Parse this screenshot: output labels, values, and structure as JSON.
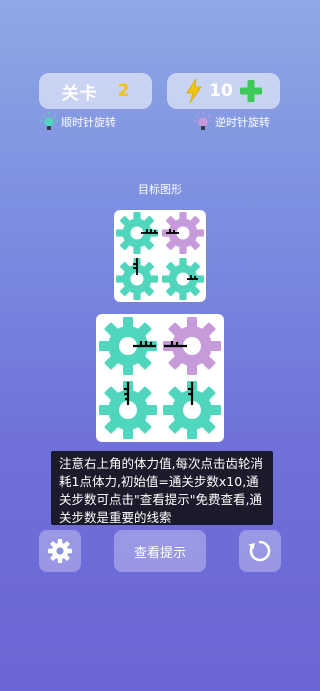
{
  "header": {
    "level_label": "关卡",
    "level_value": "2",
    "energy_value": "10",
    "energy_icon": "lightning-bolt-icon",
    "add_icon": "plus-icon"
  },
  "hints": {
    "clockwise_label": "顺时针旋转",
    "counterclockwise_label": "逆时针旋转"
  },
  "target": {
    "title": "目标图形"
  },
  "tip": {
    "text": "注意右上角的体力值,每次点击齿轮消耗1点体力,初始值=通关步数x10,通关步数可点击\"查看提示\"免费查看,通关步数是重要的线索"
  },
  "controls": {
    "settings_icon": "gear-icon",
    "hint_label": "查看提示",
    "reset_icon": "restart-icon"
  },
  "colors": {
    "clockwise_gear": "#4fd6bd",
    "counterclockwise_gear": "#c79ad9",
    "level_number": "#f1c40f",
    "energy_bolt": "#f1c40f",
    "plus": "#3ec95b"
  }
}
